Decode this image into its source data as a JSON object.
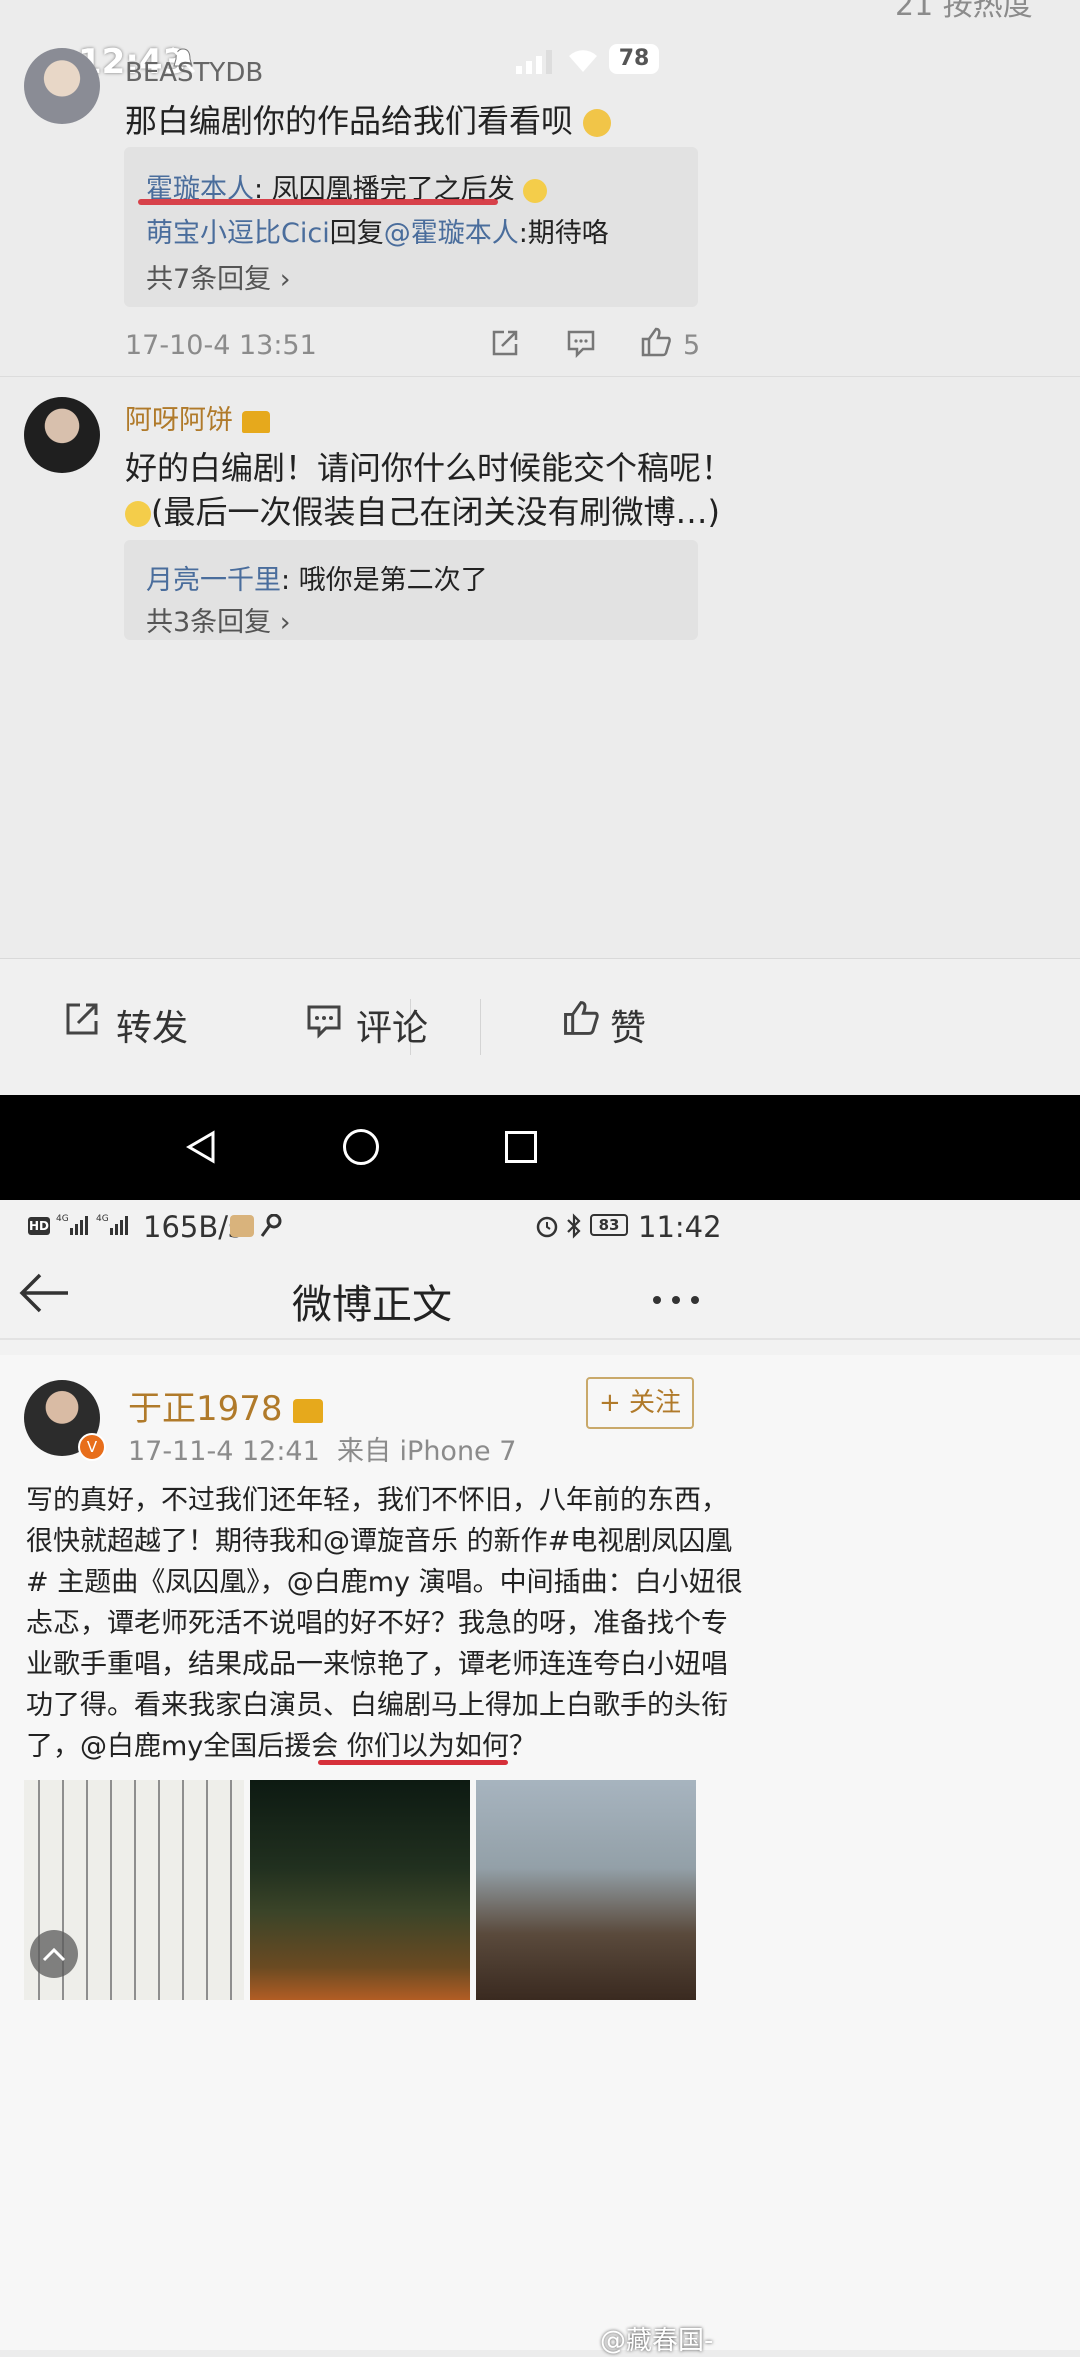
{
  "top_status": {
    "time": "12:43",
    "battery": "78"
  },
  "truncated_header": "21 按热度",
  "comment1": {
    "username": "BEASTYDB",
    "text": "那白编剧你的作品给我们看看呗",
    "replies": [
      {
        "user": "霍璇本人",
        "text": "凤囚凰播完了之后发"
      },
      {
        "user": "萌宝小逗比Cici",
        "verb": "回复",
        "mention": "@霍璇本人",
        "text": ":期待咯"
      }
    ],
    "more": "共7条回复 ›",
    "timestamp": "17-10-4 13:51",
    "likes": "5"
  },
  "comment2": {
    "username": "阿呀阿饼",
    "text_line1": "好的白编剧！请问你什么时候能交个稿呢！",
    "text_line2": "(最后一次假装自己在闭关没有刷微博…)",
    "replies": [
      {
        "user": "月亮一千里",
        "text": "哦你是第二次了"
      }
    ],
    "more": "共3条回复 ›"
  },
  "action_bar": {
    "repost": "转发",
    "comment": "评论",
    "like": "赞"
  },
  "bottom_status": {
    "speed": "165B/s",
    "battery": "83",
    "time": "11:42"
  },
  "weibo_header": {
    "title": "微博正文"
  },
  "post": {
    "username": "于正1978",
    "follow_label": "+ 关注",
    "timestamp": "17-11-4 12:41",
    "source": "来自 iPhone 7",
    "lines": [
      "写的真好，不过我们还年轻，我们不怀旧，八年前的东西，",
      "很快就超越了！期待我和@谭旋音乐 的新作#电视剧凤囚凰",
      "# 主题曲《凤囚凰》，@白鹿my 演唱。中间插曲：白小妞很",
      "忐忑，谭老师死活不说唱的好不好？我急的呀，准备找个专",
      "业歌手重唱，结果成品一来惊艳了，谭老师连连夸白小妞唱",
      "功了得。看来我家白演员、白编剧马上得加上白歌手的头衔",
      "了，@白鹿my全国后援会 你们以为如何？"
    ]
  },
  "watermark": "@藏春国-"
}
